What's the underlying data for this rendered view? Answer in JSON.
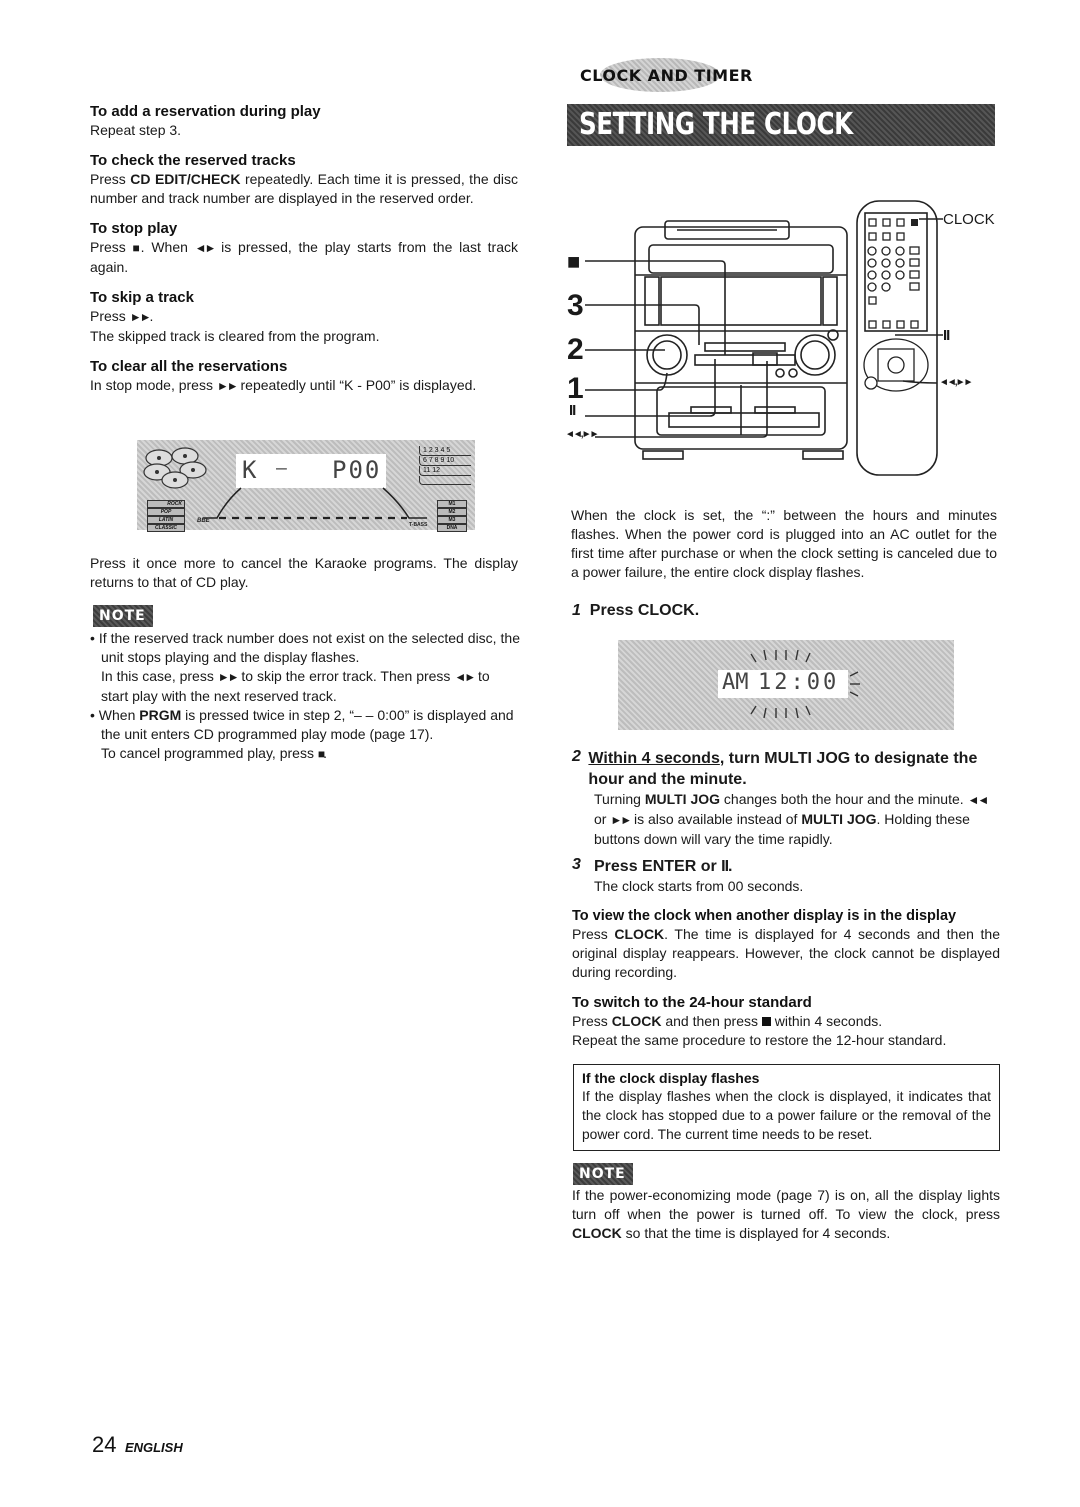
{
  "left": {
    "sections": [
      {
        "heading": "To add a reservation during play",
        "body": "Repeat step 3."
      },
      {
        "heading": "To check the reserved tracks",
        "body_pre": "Press ",
        "body_bold": "CD EDIT/CHECK",
        "body_post": " repeatedly. Each time it is pressed, the disc number and track number are displayed in the reserved order."
      },
      {
        "heading": "To stop play",
        "body_pre": "Press ",
        "stop_glyph": "■",
        "body_mid": ". When ",
        "play_pause_glyph": "◄►",
        "body_post": " is pressed, the play starts from the last track again."
      },
      {
        "heading": "To skip a track",
        "body_pre": "Press ",
        "ff_glyph": "►►",
        "body_mid": ".",
        "body_line2": "The skipped track is cleared from the program."
      },
      {
        "heading": "To clear all the reservations",
        "body_pre": "In stop mode, press ",
        "ff_glyph": "►►",
        "body_post": " repeatedly until “K - P00” is displayed."
      }
    ],
    "display_panel": {
      "left_text": "K",
      "dash": "–",
      "right_text": "P00",
      "track_numbers_row1": "1 2 3 4 5",
      "track_numbers_row2": "6 7 8 9 10",
      "track_numbers_row3": "11 12",
      "eq_modes": [
        "ROCK",
        "POP",
        "LATIN",
        "CLASSIC"
      ],
      "bbe_label": "BBE",
      "bass_label": "T-BASS",
      "memory_labels": [
        "M1",
        "M2",
        "M3",
        "DNA"
      ]
    },
    "after_display": "Press it once more to cancel the Karaoke programs. The display returns to that of CD play.",
    "note_label": "NOTE",
    "notes": [
      {
        "line1": "If the reserved track number does not exist on the selected disc, the unit stops playing and the display flashes.",
        "line2_pre": "In this case, press ",
        "ff_glyph": "►►",
        "line2_mid": " to skip the error track. Then press ",
        "play_glyph": "◄►",
        "line2_post": " to start play with the next reserved track."
      },
      {
        "pre": "When ",
        "bold": "PRGM",
        "post": " is pressed twice in step 2, “– – 0:00” is displayed and the unit enters CD programmed play mode (page 17).",
        "line2_pre": "To cancel programmed play, press ",
        "stop_glyph": "■",
        "line2_post": "."
      }
    ]
  },
  "right": {
    "section_tag": "CLOCK AND TIMER",
    "title": "SETTING THE CLOCK",
    "diagram": {
      "callouts_left": [
        "■",
        "3",
        "2",
        "1",
        "II",
        "◄◄,►►"
      ],
      "callouts_right": [
        "CLOCK",
        "II",
        "◄◄,►►"
      ]
    },
    "intro": "When the clock is set, the “:” between the hours and minutes flashes. When the power cord is plugged into an AC outlet for the first time after purchase or when the clock setting is canceled due to a power failure, the entire clock display flashes.",
    "steps": [
      {
        "num": "1",
        "title": "Press CLOCK."
      },
      {
        "num": "2",
        "title_underlined": "Within 4 seconds",
        "title_rest": ", turn MULTI JOG to designate the hour and the minute.",
        "body_pre": "Turning ",
        "body_bold1": "MULTI JOG",
        "body_mid1": " changes both the hour and the minute. ",
        "rew_glyph": "◄◄",
        "body_mid2": " or ",
        "ff_glyph": "►►",
        "body_mid3": " is also available instead of ",
        "body_bold2": "MULTI JOG",
        "body_post": ". Holding these buttons down will vary the time rapidly."
      },
      {
        "num": "3",
        "title": "Press ENTER or ",
        "pause_glyph": "II",
        "title_end": ".",
        "body": "The clock starts from 00 seconds."
      }
    ],
    "clock_display": {
      "ampm": "AM",
      "time": "12:00"
    },
    "view_clock": {
      "heading": "To view the clock when another display is in the display",
      "body_pre": "Press ",
      "body_bold": "CLOCK",
      "body_post": ". The time is displayed for 4 seconds and then the original display reappears. However, the clock cannot be displayed during recording."
    },
    "switch_24": {
      "heading": "To switch to the 24-hour standard",
      "body_pre": "Press ",
      "body_bold": "CLOCK",
      "body_mid": " and then press ",
      "stop_glyph": "■",
      "body_post": " within 4 seconds.",
      "body_line2": "Repeat the same procedure to restore the 12-hour standard."
    },
    "flash_box": {
      "heading": "If the clock display flashes",
      "body": "If the display flashes when the clock is displayed, it indicates that the clock has stopped due to a power failure or the removal of the power cord. The current time needs to be reset."
    },
    "note_label": "NOTE",
    "note_pre": "If the power-economizing mode (page 7) is on, all the display lights turn off when the power is turned off. To view the clock, press ",
    "note_bold": "CLOCK",
    "note_post": " so that the time is displayed for 4 seconds."
  },
  "footer": {
    "page_number": "24",
    "language": "ENGLISH"
  }
}
